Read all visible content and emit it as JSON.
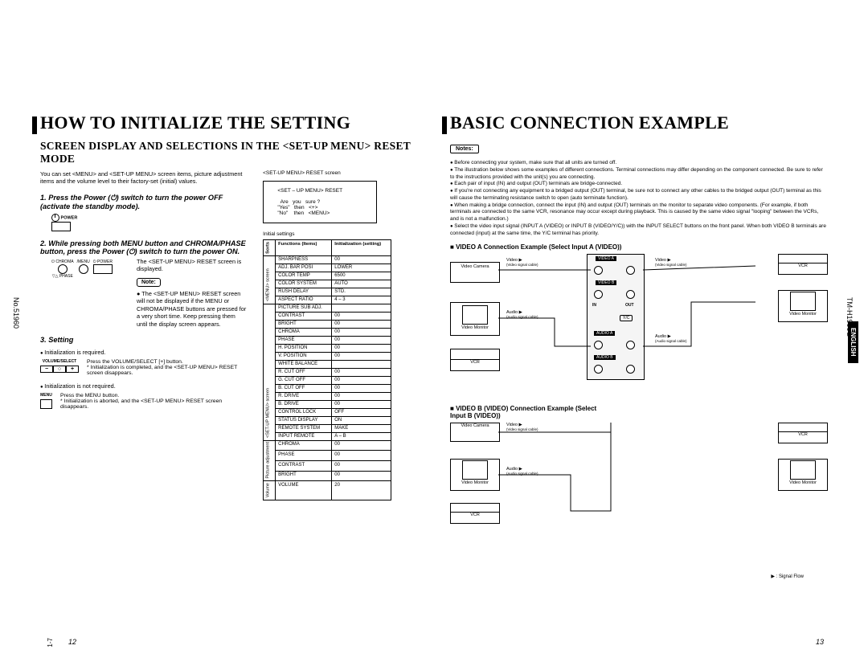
{
  "sideLabels": {
    "docNo": "No.51960",
    "model": "TM-H1900G",
    "lang": "ENGLISH",
    "binder": "1-7"
  },
  "pages": {
    "left": "12",
    "right": "13"
  },
  "left": {
    "title": "HOW TO INITIALIZE THE SETTING",
    "subtitle": "SCREEN DISPLAY AND SELECTIONS IN THE <SET-UP MENU> RESET MODE",
    "intro": "You can set <MENU> and <SET-UP MENU> screen items, picture adjustment items and the volume level to their factory-set (initial) values.",
    "step1": "1. Press the Power (⏻) switch to turn the power OFF (activate the standby mode).",
    "powerLabel": "POWER",
    "step2": "2. While pressing both MENU button and CHROMA/PHASE button, press the Power (⏻) switch to turn the power ON.",
    "resetShown": "The <SET-UP MENU> RESET screen is displayed.",
    "noteTag": "Note:",
    "noteText": "● The <SET-UP MENU> RESET screen will not be displayed if the MENU or CHROMA/PHASE buttons are pressed for a very short time. Keep pressing them until the display screen appears.",
    "step3": "3. Setting",
    "initReq": "Initialization is required.",
    "volLabel": "VOLUME/SELECT",
    "reqText": "Press the VOLUME/SELECT [+] button.\n* Initialization is completed, and the <SET-UP MENU> RESET screen disappears.",
    "initNotReq": "Initialization is not required.",
    "menuLabel": "MENU",
    "notReqText": "Press the MENU button.\n* Initialization is aborted, and the <SET-UP MENU> RESET screen disappears.",
    "screenTitle": "<SET-UP MENU> RESET screen",
    "screenContent": "    <SET – UP MENU> RESET\n\n      Are   you   sure ?\n    \"Yes\"   then   <+>\n    \"No\"    then   <MENU>",
    "initCap": "Initial settings",
    "tableHead": {
      "sorts": "Sorts",
      "func": "Functions (Items)",
      "init": "Initialization (setting)"
    },
    "menuGroup": "<MENU> screen",
    "menuRows": [
      [
        "SHARPNESS",
        "00"
      ],
      [
        "ADJ. BAR POSI",
        "LOWER"
      ],
      [
        "COLOR TEMP",
        "6500"
      ],
      [
        "COLOR SYSTEM",
        "AUTO"
      ],
      [
        "RUSH DELAY",
        "STD."
      ],
      [
        "ASPECT RATIO",
        "4 – 3"
      ]
    ],
    "setupGroup": "<SET-UP MENU> screen",
    "setupRows": [
      [
        "PICTURE SUB ADJ.",
        ""
      ],
      [
        "   CONTRAST",
        "00"
      ],
      [
        "   BRIGHT",
        "00"
      ],
      [
        "   CHROMA",
        "00"
      ],
      [
        "   PHASE",
        "00"
      ],
      [
        "   H. POSITION",
        "00"
      ],
      [
        "   V. POSITION",
        "00"
      ],
      [
        "WHITE BALANCE",
        ""
      ],
      [
        "   R. CUT OFF",
        "00"
      ],
      [
        "   G. CUT OFF",
        "00"
      ],
      [
        "   B. CUT OFF",
        "00"
      ],
      [
        "   R. DRIVE",
        "00"
      ],
      [
        "   B. DRIVE",
        "00"
      ],
      [
        "CONTROL LOCK",
        "OFF"
      ],
      [
        "STATUS DISPLAY",
        "ON"
      ],
      [
        "REMOTE SYSTEM",
        "MAKE"
      ],
      [
        "INPUT REMOTE",
        "A – B"
      ]
    ],
    "picGroup": "Picture adjustment",
    "picRows": [
      [
        "CHROMA",
        "00"
      ],
      [
        "PHASE",
        "00"
      ],
      [
        "CONTRAST",
        "00"
      ],
      [
        "BRIGHT",
        "00"
      ]
    ],
    "volGroup": "Volume",
    "volRows": [
      [
        "VOLUME",
        "20"
      ]
    ]
  },
  "right": {
    "title": "BASIC CONNECTION EXAMPLE",
    "notesTag": "Notes:",
    "notes": [
      "Before connecting your system, make sure that all units are turned off.",
      "The illustration below shows some examples of different connections. Terminal connections may differ depending on the component connected. Be sure to refer to the instructions provided with the unit(s) you are connecting.",
      "Each pair of input (IN) and output (OUT) terminals are bridge-connected.",
      "If you're not connecting any equipment to a bridged output (OUT) terminal, be sure not to connect any other cables to the bridged output (OUT) terminal as this will cause the terminating resistance switch to open (auto terminate function).",
      "When making a bridge connection, connect the input (IN) and output (OUT) terminals on the monitor to separate video components. (For example, if both terminals are connected to the same VCR, resonance may occur except during playback. This is caused by the same video signal \"looping\" between the VCRs, and is not a malfunction.)",
      "Select the video input signal (INPUT A (VIDEO) or INPUT B (VIDEO/Y/C)) with the INPUT SELECT buttons on the front panel. When both VIDEO B terminals are connected (input) at the same time, the Y/C terminal has priority."
    ],
    "connA": "VIDEO A Connection Example (Select Input A (VIDEO))",
    "connB": "VIDEO B (VIDEO) Connection Example (Select Input B (VIDEO))",
    "devices": {
      "cam": "Video Camera",
      "mon": "Video Monitor",
      "vcr": "VCR"
    },
    "sigLabels": {
      "video": "Video",
      "audio": "Audio",
      "vcable": "(Video signal cable)",
      "acable": "(Audio signal cable)"
    },
    "panelLabels": {
      "va": "VIDEO A",
      "vb": "VIDEO B",
      "aa": "AUDIO A",
      "ab": "AUDIO B",
      "yc": "Y/C",
      "in": "IN",
      "out": "OUT"
    },
    "sigflow": "▶ : Signal Flow"
  }
}
